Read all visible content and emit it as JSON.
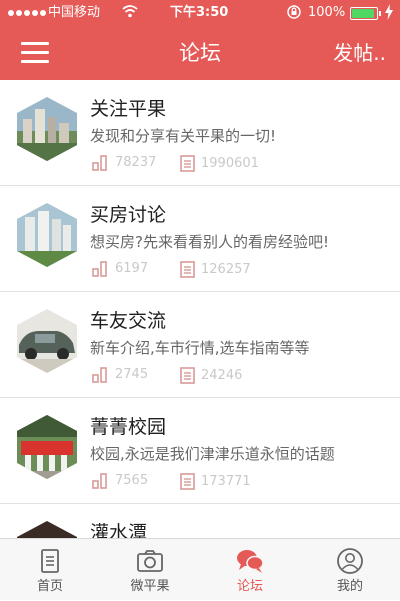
{
  "status_bar": {
    "carrier": "中国移动",
    "time": "下午3:50",
    "battery": "100%",
    "battery_level": 1.0,
    "icons": [
      "signal-dots-icon",
      "wifi-icon",
      "rotation-lock-icon",
      "battery-icon",
      "charging-bolt-icon"
    ]
  },
  "nav": {
    "title": "论坛",
    "action_label": "发帖..",
    "menu_icon": "hamburger-menu-icon"
  },
  "forums": [
    {
      "title": "关注平果",
      "description": "发现和分享有关平果的一切!",
      "stat_a": "78237",
      "stat_b": "1990601",
      "thumb": "city-skyline-photo"
    },
    {
      "title": "买房讨论",
      "description": "想买房?先来看看别人的看房经验吧!",
      "stat_a": "6197",
      "stat_b": "126257",
      "thumb": "apartment-towers-photo"
    },
    {
      "title": "车友交流",
      "description": "新车介绍,车市行情,选车指南等等",
      "stat_a": "2745",
      "stat_b": "24246",
      "thumb": "vintage-car-photo"
    },
    {
      "title": "菁菁校园",
      "description": "校园,永远是我们津津乐道永恒的话题",
      "stat_a": "7565",
      "stat_b": "173771",
      "thumb": "school-parade-photo"
    },
    {
      "title": "灌水潭",
      "description": "",
      "stat_a": "",
      "stat_b": "",
      "thumb": "dark-photo"
    }
  ],
  "tabs": [
    {
      "label": "首页",
      "icon": "document-icon",
      "active": false
    },
    {
      "label": "微平果",
      "icon": "camera-icon",
      "active": false
    },
    {
      "label": "论坛",
      "icon": "chat-bubbles-icon",
      "active": true
    },
    {
      "label": "我的",
      "icon": "user-icon",
      "active": false
    }
  ],
  "colors": {
    "brand": "#e55a57",
    "stat_text": "#c9c9c9",
    "stat_icon": "#d99a97",
    "tab_inactive": "#555555",
    "battery_fill": "#4fd964"
  }
}
